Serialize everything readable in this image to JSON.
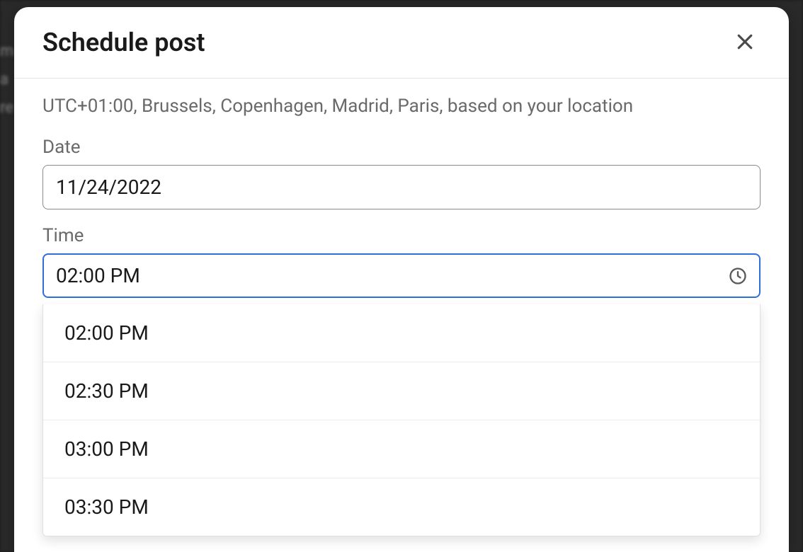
{
  "modal": {
    "title": "Schedule post",
    "timezone_info": "UTC+01:00, Brussels, Copenhagen, Madrid, Paris, based on your location",
    "date_label": "Date",
    "date_value": "11/24/2022",
    "time_label": "Time",
    "time_value": "02:00 PM",
    "time_options": [
      "02:00 PM",
      "02:30 PM",
      "03:00 PM",
      "03:30 PM"
    ]
  }
}
